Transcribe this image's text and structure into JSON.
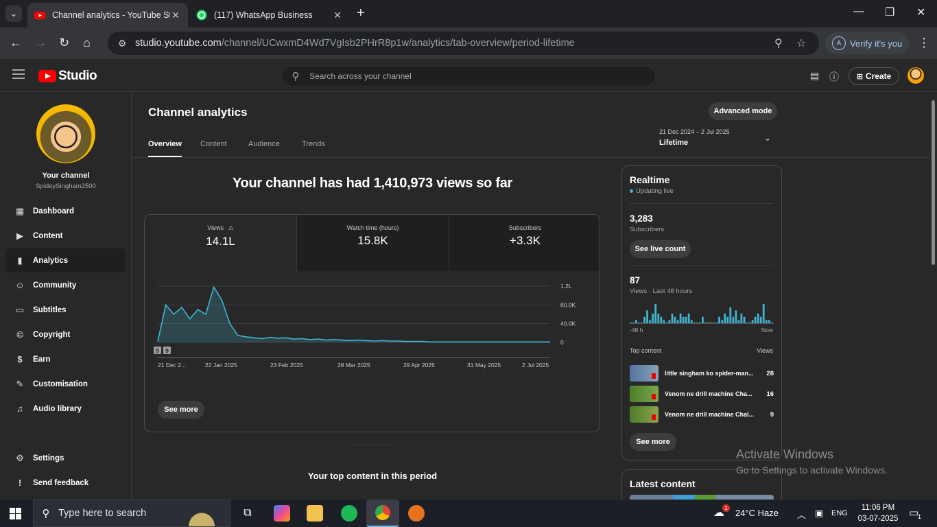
{
  "browser": {
    "tabs": [
      {
        "title": "Channel analytics - YouTube Studio",
        "active": true
      },
      {
        "title": "(117) WhatsApp Business",
        "active": false
      }
    ],
    "url_host": "studio.youtube.com",
    "url_path": "/channel/UCwxmD4Wd7VgIsb2PHrR8p1w/analytics/tab-overview/period-lifetime",
    "verify_label": "Verify it's you",
    "verify_avatar": "A"
  },
  "studio": {
    "logo_text": "Studio",
    "search_placeholder": "Search across your channel",
    "create_label": "Create"
  },
  "sidebar": {
    "channel_name": "Your channel",
    "channel_handle": "SpideySingham2500",
    "items": [
      {
        "label": "Dashboard",
        "icon": "dashboard-icon"
      },
      {
        "label": "Content",
        "icon": "content-icon"
      },
      {
        "label": "Analytics",
        "icon": "analytics-icon",
        "active": true
      },
      {
        "label": "Community",
        "icon": "community-icon"
      },
      {
        "label": "Subtitles",
        "icon": "subtitles-icon"
      },
      {
        "label": "Copyright",
        "icon": "copyright-icon"
      },
      {
        "label": "Earn",
        "icon": "earn-icon"
      },
      {
        "label": "Customisation",
        "icon": "customisation-icon"
      },
      {
        "label": "Audio library",
        "icon": "audio-library-icon"
      }
    ],
    "settings_label": "Settings",
    "feedback_label": "Send feedback"
  },
  "main": {
    "title": "Channel analytics",
    "advanced_mode_label": "Advanced mode",
    "tabs": [
      "Overview",
      "Content",
      "Audience",
      "Trends"
    ],
    "active_tab": "Overview",
    "period_range": "21 Dec 2024 – 2 Jul 2025",
    "period_label": "Lifetime",
    "headline": "Your channel has had 1,410,973 views so far",
    "metrics": [
      {
        "label": "Views",
        "value": "14.1L",
        "warning": true
      },
      {
        "label": "Watch time (hours)",
        "value": "15.8K"
      },
      {
        "label": "Subscribers",
        "value": "+3.3K"
      }
    ],
    "see_more_label": "See more",
    "top_content_title": "Your top content in this period"
  },
  "chart_data": {
    "type": "area",
    "series": [
      {
        "values": [
          2,
          80,
          60,
          75,
          50,
          70,
          60,
          118,
          90,
          40,
          15,
          12,
          10,
          8,
          11,
          9,
          10,
          7,
          8,
          6,
          7,
          5,
          6,
          5,
          4,
          5,
          4,
          3,
          4,
          3,
          3,
          2,
          2,
          2,
          1,
          1,
          1,
          1,
          1,
          1,
          1,
          1,
          1,
          1,
          1,
          1,
          1,
          1,
          1,
          1
        ]
      }
    ],
    "y_unit": "K",
    "x_ticks": [
      "21 Dec 2...",
      "22 Jan 2025",
      "23 Feb 2025",
      "28 Mar 2025",
      "29 Apr 2025",
      "31 May 2025",
      "2 Jul 2025"
    ],
    "y_ticks": [
      "1.2L",
      "80.0K",
      "40.0K",
      "0"
    ],
    "ylim": [
      0,
      120
    ],
    "markers": [
      "9",
      "9"
    ],
    "color": "#41b4d1"
  },
  "realtime": {
    "title": "Realtime",
    "status": "Updating live",
    "subscribers_value": "3,283",
    "subscribers_label": "Subscribers",
    "see_live_label": "See live count",
    "views_value": "87",
    "views_label": "Views · Last 48 hours",
    "axis_start": "-48 h",
    "axis_end": "Now",
    "bars": [
      0,
      0,
      1,
      0,
      0,
      2,
      4,
      1,
      3,
      6,
      3,
      2,
      1,
      0,
      1,
      3,
      2,
      1,
      3,
      2,
      2,
      3,
      1,
      0,
      0,
      0,
      2,
      0,
      0,
      0,
      0,
      0,
      2,
      1,
      3,
      2,
      5,
      2,
      4,
      1,
      3,
      2,
      0,
      0,
      1,
      2,
      3,
      2,
      6,
      1,
      1,
      0
    ],
    "top_content_label": "Top content",
    "views_col_label": "Views",
    "top_content": [
      {
        "title": "little singham ko spider-man...",
        "views": "28"
      },
      {
        "title": "Venom ne drill machine Cha...",
        "views": "16"
      },
      {
        "title": "Venom ne drill machine Chal...",
        "views": "9"
      }
    ],
    "see_more_label": "See more"
  },
  "latest_content": {
    "title": "Latest content"
  },
  "watermark": {
    "line1": "Activate Windows",
    "line2": "Go to Settings to activate Windows."
  },
  "taskbar": {
    "search_placeholder": "Type here to search",
    "weather": "24°C  Haze",
    "weather_badge": "1",
    "language": "ENG",
    "time": "11:06 PM",
    "date": "03-07-2025",
    "notification_count": "1"
  }
}
